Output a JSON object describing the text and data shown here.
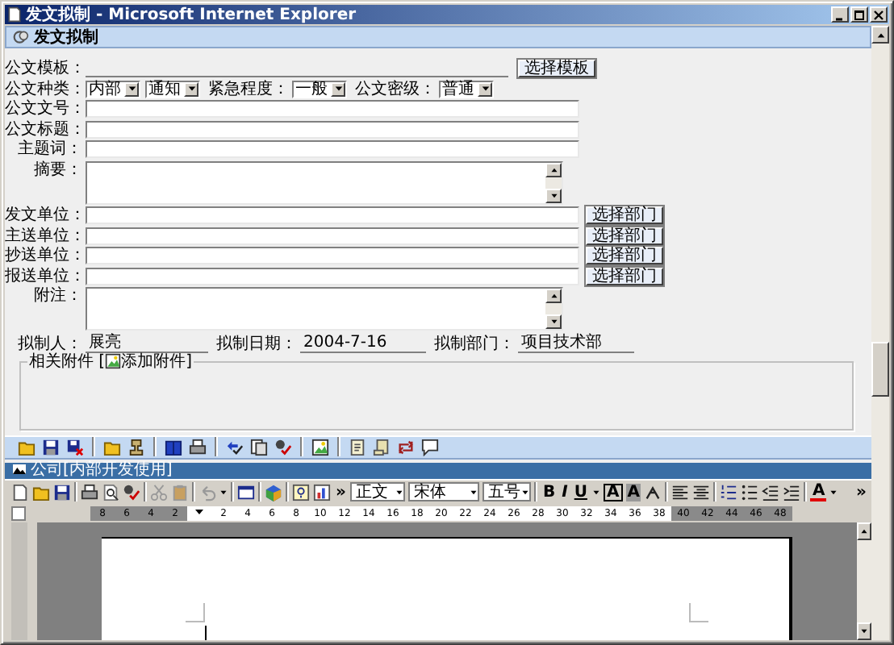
{
  "window": {
    "title": "发文拟制 - Microsoft Internet Explorer"
  },
  "header": {
    "title": "发文拟制"
  },
  "template": {
    "label": "公文模板：",
    "button": "选择模板"
  },
  "type_row": [
    {
      "kind": "label",
      "text": "公文种类："
    },
    {
      "kind": "select",
      "value": "内部"
    },
    {
      "kind": "select",
      "value": "通知"
    },
    {
      "kind": "label",
      "text": "紧急程度："
    },
    {
      "kind": "select",
      "value": "一般"
    },
    {
      "kind": "label",
      "text": "公文密级："
    },
    {
      "kind": "select",
      "value": "普通"
    }
  ],
  "fields": [
    {
      "kind": "text",
      "label": "公文文号："
    },
    {
      "kind": "text",
      "label": "公文标题："
    },
    {
      "kind": "text",
      "label": "主题词："
    },
    {
      "kind": "textarea",
      "label": "摘要："
    },
    {
      "kind": "text",
      "label": "发文单位：",
      "button": "选择部门"
    },
    {
      "kind": "text",
      "label": "主送单位：",
      "button": "选择部门"
    },
    {
      "kind": "text",
      "label": "抄送单位：",
      "button": "选择部门"
    },
    {
      "kind": "text",
      "label": "报送单位：",
      "button": "选择部门"
    },
    {
      "kind": "textarea",
      "label": "附注："
    }
  ],
  "footer": [
    {
      "label": "拟制人：",
      "value": "展亮"
    },
    {
      "label": "拟制日期：",
      "value": "2004-7-16"
    },
    {
      "label": "拟制部门：",
      "value": "项目技术部"
    }
  ],
  "attachments": {
    "legend": "相关附件 [",
    "action": "添加附件]"
  },
  "doc_banner": "公司[内部开发使用]",
  "word_toolbar": {
    "more": "»",
    "style": "正文",
    "font": "宋体",
    "size": "五号",
    "format_buttons": [
      "B",
      "I",
      "U"
    ],
    "char_buttons": [
      "A",
      "A"
    ],
    "font_color": "A",
    "end_more": "»"
  },
  "ruler": {
    "left_numbers": [
      "8",
      "6",
      "4",
      "2"
    ],
    "numbers": [
      "2",
      "4",
      "6",
      "8",
      "10",
      "12",
      "14",
      "16",
      "18",
      "20",
      "22",
      "24",
      "26",
      "28",
      "30",
      "32",
      "34",
      "36",
      "38"
    ],
    "right_numbers": [
      "40",
      "42",
      "44",
      "46",
      "48"
    ]
  }
}
